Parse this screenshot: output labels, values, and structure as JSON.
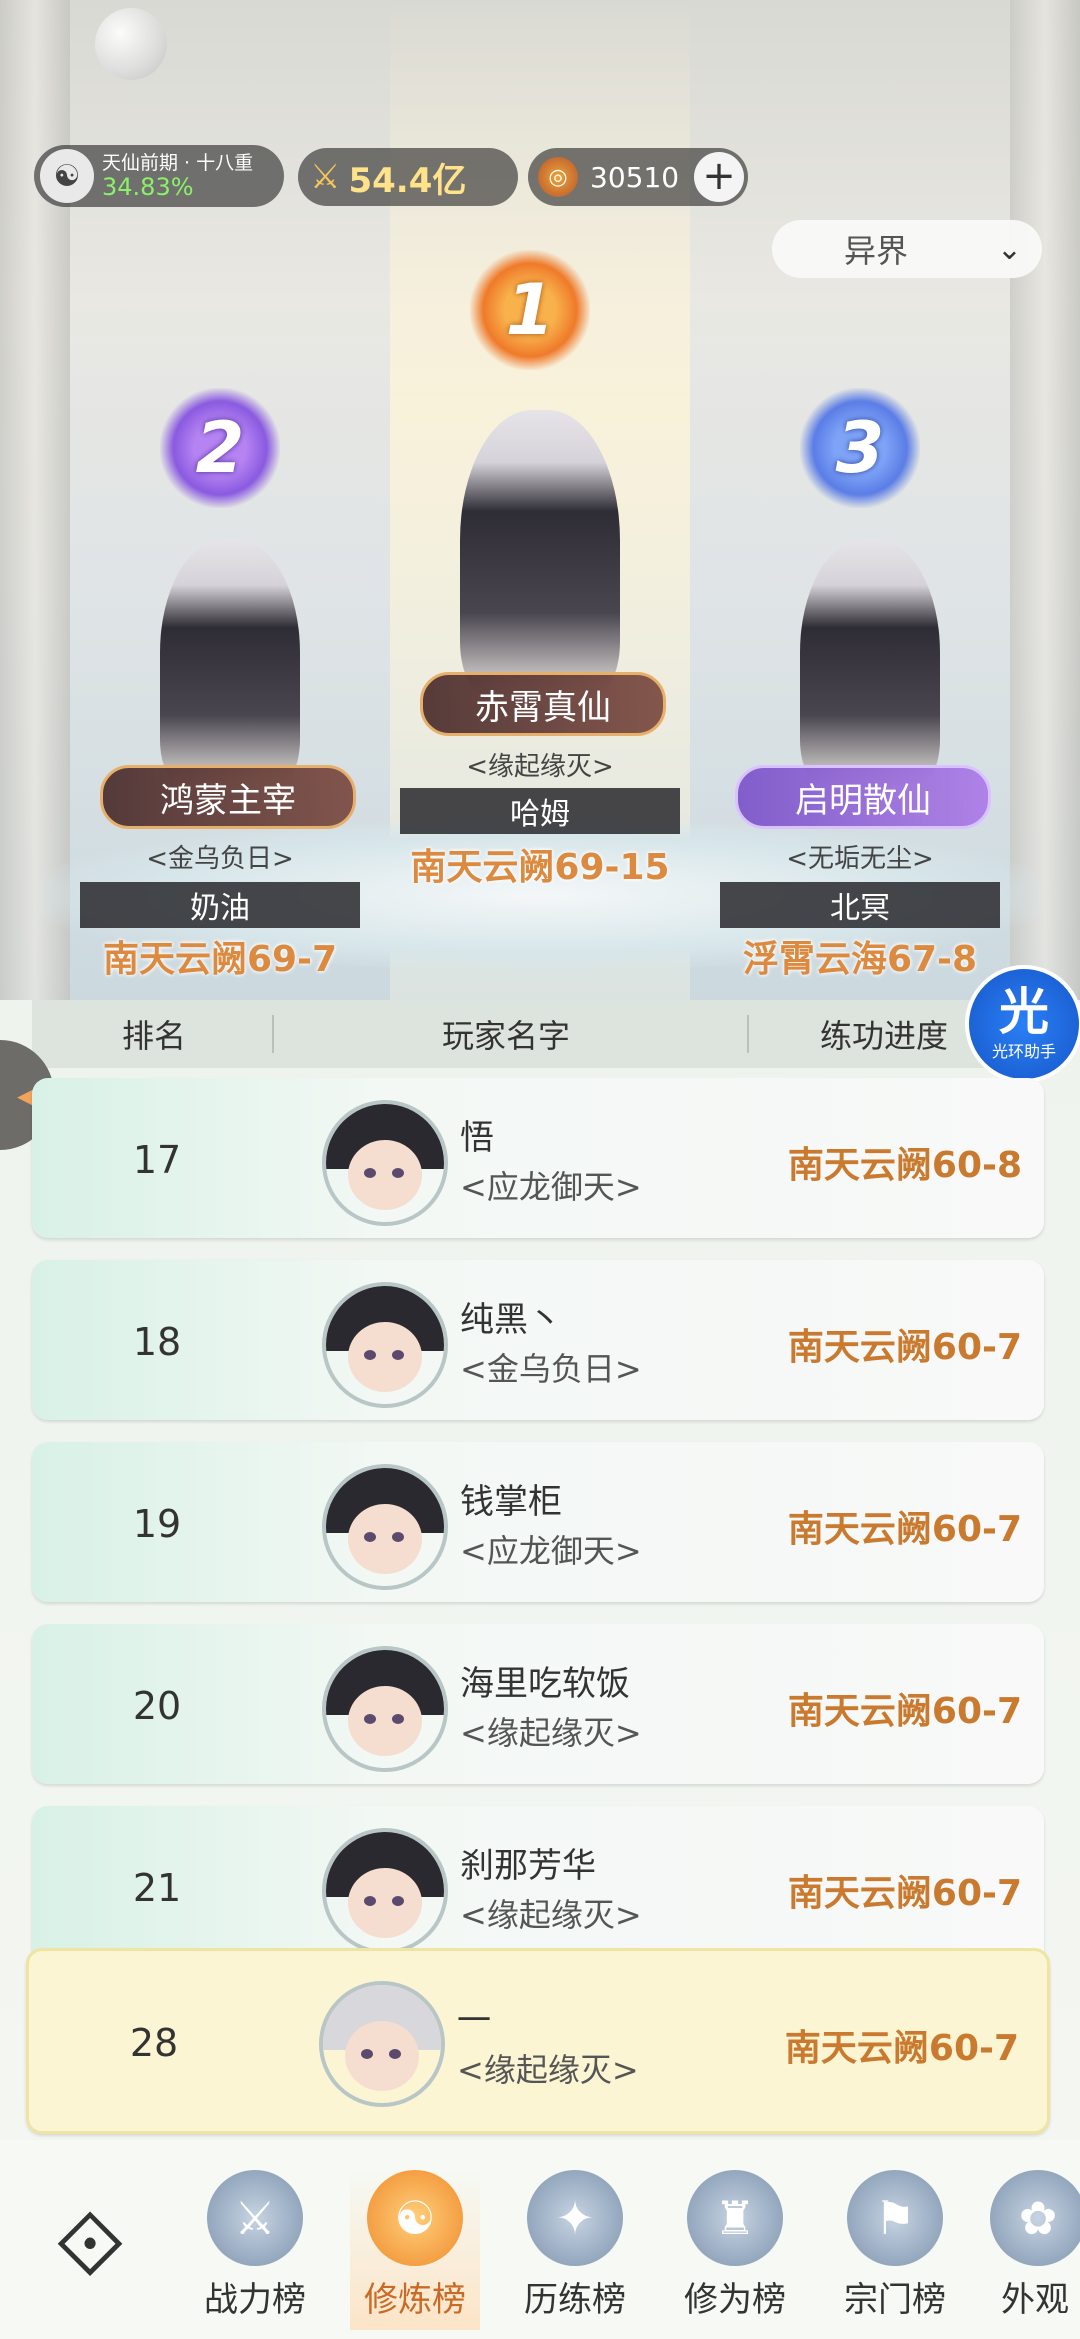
{
  "top_bar": {
    "realm_label": "天仙前期 · 十八重",
    "realm_percent": "34.83%",
    "power_value": "54.4亿",
    "coins": "30510",
    "plus_icon": "plus-icon",
    "dropdown_label": "异界"
  },
  "podium": {
    "first": {
      "rank": "1",
      "title": "赤霄真仙",
      "guild": "<缘起缘灭>",
      "player": "哈姆",
      "progress": "南天云阙69-15"
    },
    "second": {
      "rank": "2",
      "title": "鸿蒙主宰",
      "guild": "<金乌负日>",
      "player": "奶油",
      "progress": "南天云阙69-7"
    },
    "third": {
      "rank": "3",
      "title": "启明散仙",
      "guild": "<无垢无尘>",
      "player": "北冥",
      "progress": "浮霄云海67-8"
    }
  },
  "table": {
    "headers": {
      "rank": "排名",
      "name": "玩家名字",
      "progress": "练功进度"
    },
    "rows": [
      {
        "rank": "17",
        "name": "悟",
        "guild": "<应龙御天>",
        "progress": "南天云阙60-8"
      },
      {
        "rank": "18",
        "name": "纯黑丶",
        "guild": "<金乌负日>",
        "progress": "南天云阙60-7"
      },
      {
        "rank": "19",
        "name": "钱掌柜",
        "guild": "<应龙御天>",
        "progress": "南天云阙60-7"
      },
      {
        "rank": "20",
        "name": "海里吃软饭",
        "guild": "<缘起缘灭>",
        "progress": "南天云阙60-7"
      },
      {
        "rank": "21",
        "name": "刹那芳华",
        "guild": "<缘起缘灭>",
        "progress": "南天云阙60-7"
      }
    ],
    "me": {
      "rank": "28",
      "name": "一",
      "guild": "<缘起缘灭>",
      "progress": "南天云阙60-7"
    }
  },
  "helper": {
    "big": "光",
    "small": "光环助手"
  },
  "nav": {
    "tabs": [
      {
        "label": "战力榜"
      },
      {
        "label": "修炼榜"
      },
      {
        "label": "历练榜"
      },
      {
        "label": "修为榜"
      },
      {
        "label": "宗门榜"
      },
      {
        "label": "外观"
      }
    ]
  },
  "colors": {
    "accent": "#c97a2e",
    "active_tab": "#f08a2c",
    "realm_percent": "#8bf06a"
  }
}
